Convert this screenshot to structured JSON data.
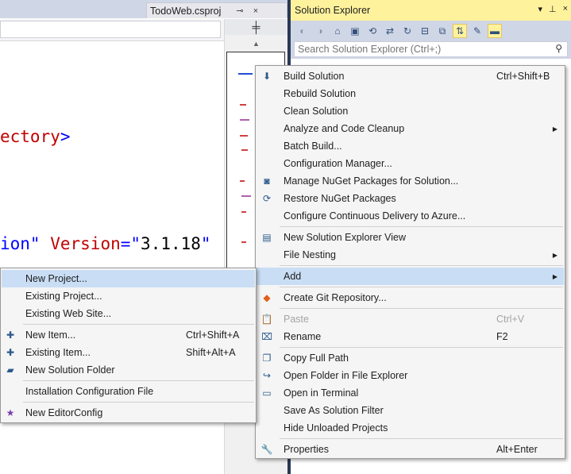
{
  "editor": {
    "tab": {
      "label": "TodoWeb.csproj",
      "pin_glyph": "⊸",
      "close_glyph": "×"
    },
    "code_lines": [
      {
        "parts": [
          {
            "cls": "tok-red",
            "text": "ectory"
          },
          {
            "cls": "tok-blue",
            "text": ">"
          }
        ]
      },
      {
        "parts": [
          {
            "cls": "tok-blue",
            "text": "ion\""
          },
          {
            "cls": "tok-txt",
            "text": " "
          },
          {
            "cls": "tok-red",
            "text": "Version"
          },
          {
            "cls": "tok-blue",
            "text": "=\""
          },
          {
            "cls": "tok-txt",
            "text": "3.1.18"
          },
          {
            "cls": "tok-blue",
            "text": "\""
          }
        ]
      }
    ],
    "split_glyph": "╪",
    "scroll_up_glyph": "▲"
  },
  "solution_explorer": {
    "title": "Solution Explorer",
    "title_buttons": [
      "▾",
      "⊥",
      "×"
    ],
    "toolbar_icons": [
      {
        "name": "back-icon",
        "glyph": "◐",
        "dim": true
      },
      {
        "name": "forward-icon",
        "glyph": "◑",
        "dim": true
      },
      {
        "name": "home-icon",
        "glyph": "⌂",
        "dim": false
      },
      {
        "name": "switch-views-icon",
        "glyph": "▣",
        "dim": false
      },
      {
        "name": "pending-changes-icon",
        "glyph": "⟲",
        "dim": false
      },
      {
        "name": "sync-icon",
        "glyph": "⇄",
        "dim": false
      },
      {
        "name": "refresh-icon",
        "glyph": "↻",
        "dim": false
      },
      {
        "name": "collapse-all-icon",
        "glyph": "⊟",
        "dim": false
      },
      {
        "name": "show-all-files-icon",
        "glyph": "⧉",
        "dim": false
      },
      {
        "name": "track-active-icon",
        "glyph": "⇅",
        "active": true
      },
      {
        "name": "properties-wrench-icon",
        "glyph": "✎",
        "dim": false
      },
      {
        "name": "preview-icon",
        "glyph": "▬",
        "active": true
      }
    ],
    "search_placeholder": "Search Solution Explorer (Ctrl+;)",
    "search_glyph": "⚲"
  },
  "context_menu": {
    "items": [
      {
        "type": "item",
        "label": "Build Solution",
        "shortcut": "Ctrl+Shift+B",
        "icon": "build-icon",
        "glyph": "⬇"
      },
      {
        "type": "item",
        "label": "Rebuild Solution"
      },
      {
        "type": "item",
        "label": "Clean Solution"
      },
      {
        "type": "item",
        "label": "Analyze and Code Cleanup",
        "submenu": true
      },
      {
        "type": "item",
        "label": "Batch Build..."
      },
      {
        "type": "item",
        "label": "Configuration Manager..."
      },
      {
        "type": "item",
        "label": "Manage NuGet Packages for Solution...",
        "icon": "nuget-icon",
        "glyph": "◙"
      },
      {
        "type": "item",
        "label": "Restore NuGet Packages",
        "icon": "restore-icon",
        "glyph": "⟳"
      },
      {
        "type": "item",
        "label": "Configure Continuous Delivery to Azure..."
      },
      {
        "type": "sep"
      },
      {
        "type": "item",
        "label": "New Solution Explorer View",
        "icon": "new-view-icon",
        "glyph": "▤"
      },
      {
        "type": "item",
        "label": "File Nesting",
        "submenu": true
      },
      {
        "type": "sep"
      },
      {
        "type": "item",
        "label": "Add",
        "submenu": true,
        "highlight": true
      },
      {
        "type": "sep"
      },
      {
        "type": "item",
        "label": "Create Git Repository...",
        "icon": "git-icon",
        "glyph": "◆"
      },
      {
        "type": "sep"
      },
      {
        "type": "item",
        "label": "Paste",
        "shortcut": "Ctrl+V",
        "disabled": true,
        "icon": "paste-icon",
        "glyph": "📋"
      },
      {
        "type": "item",
        "label": "Rename",
        "shortcut": "F2",
        "icon": "rename-icon",
        "glyph": "⌧"
      },
      {
        "type": "sep"
      },
      {
        "type": "item",
        "label": "Copy Full Path",
        "icon": "copy-path-icon",
        "glyph": "❐"
      },
      {
        "type": "item",
        "label": "Open Folder in File Explorer",
        "icon": "open-folder-icon",
        "glyph": "↪"
      },
      {
        "type": "item",
        "label": "Open in Terminal",
        "icon": "terminal-icon",
        "glyph": "▭"
      },
      {
        "type": "item",
        "label": "Save As Solution Filter"
      },
      {
        "type": "item",
        "label": "Hide Unloaded Projects"
      },
      {
        "type": "sep"
      },
      {
        "type": "item",
        "label": "Properties",
        "shortcut": "Alt+Enter",
        "icon": "wrench-icon",
        "glyph": "🔧"
      }
    ]
  },
  "add_submenu": {
    "items": [
      {
        "type": "item",
        "label": "New Project...",
        "highlight": true
      },
      {
        "type": "item",
        "label": "Existing Project..."
      },
      {
        "type": "item",
        "label": "Existing Web Site..."
      },
      {
        "type": "sep"
      },
      {
        "type": "item",
        "label": "New Item...",
        "shortcut": "Ctrl+Shift+A",
        "icon": "new-item-icon",
        "glyph": "✚"
      },
      {
        "type": "item",
        "label": "Existing Item...",
        "shortcut": "Shift+Alt+A",
        "icon": "existing-item-icon",
        "glyph": "✚"
      },
      {
        "type": "item",
        "label": "New Solution Folder",
        "icon": "solution-folder-icon",
        "glyph": "▰"
      },
      {
        "type": "sep"
      },
      {
        "type": "item",
        "label": "Installation Configuration File"
      },
      {
        "type": "sep"
      },
      {
        "type": "item",
        "label": "New EditorConfig",
        "icon": "editorconfig-icon",
        "glyph": "★"
      }
    ]
  },
  "colors": {
    "accent_yellow": "#fff29d",
    "menu_highlight": "#c9def5",
    "tool_blue": "#cfd6e5",
    "frame_dark": "#293955"
  }
}
